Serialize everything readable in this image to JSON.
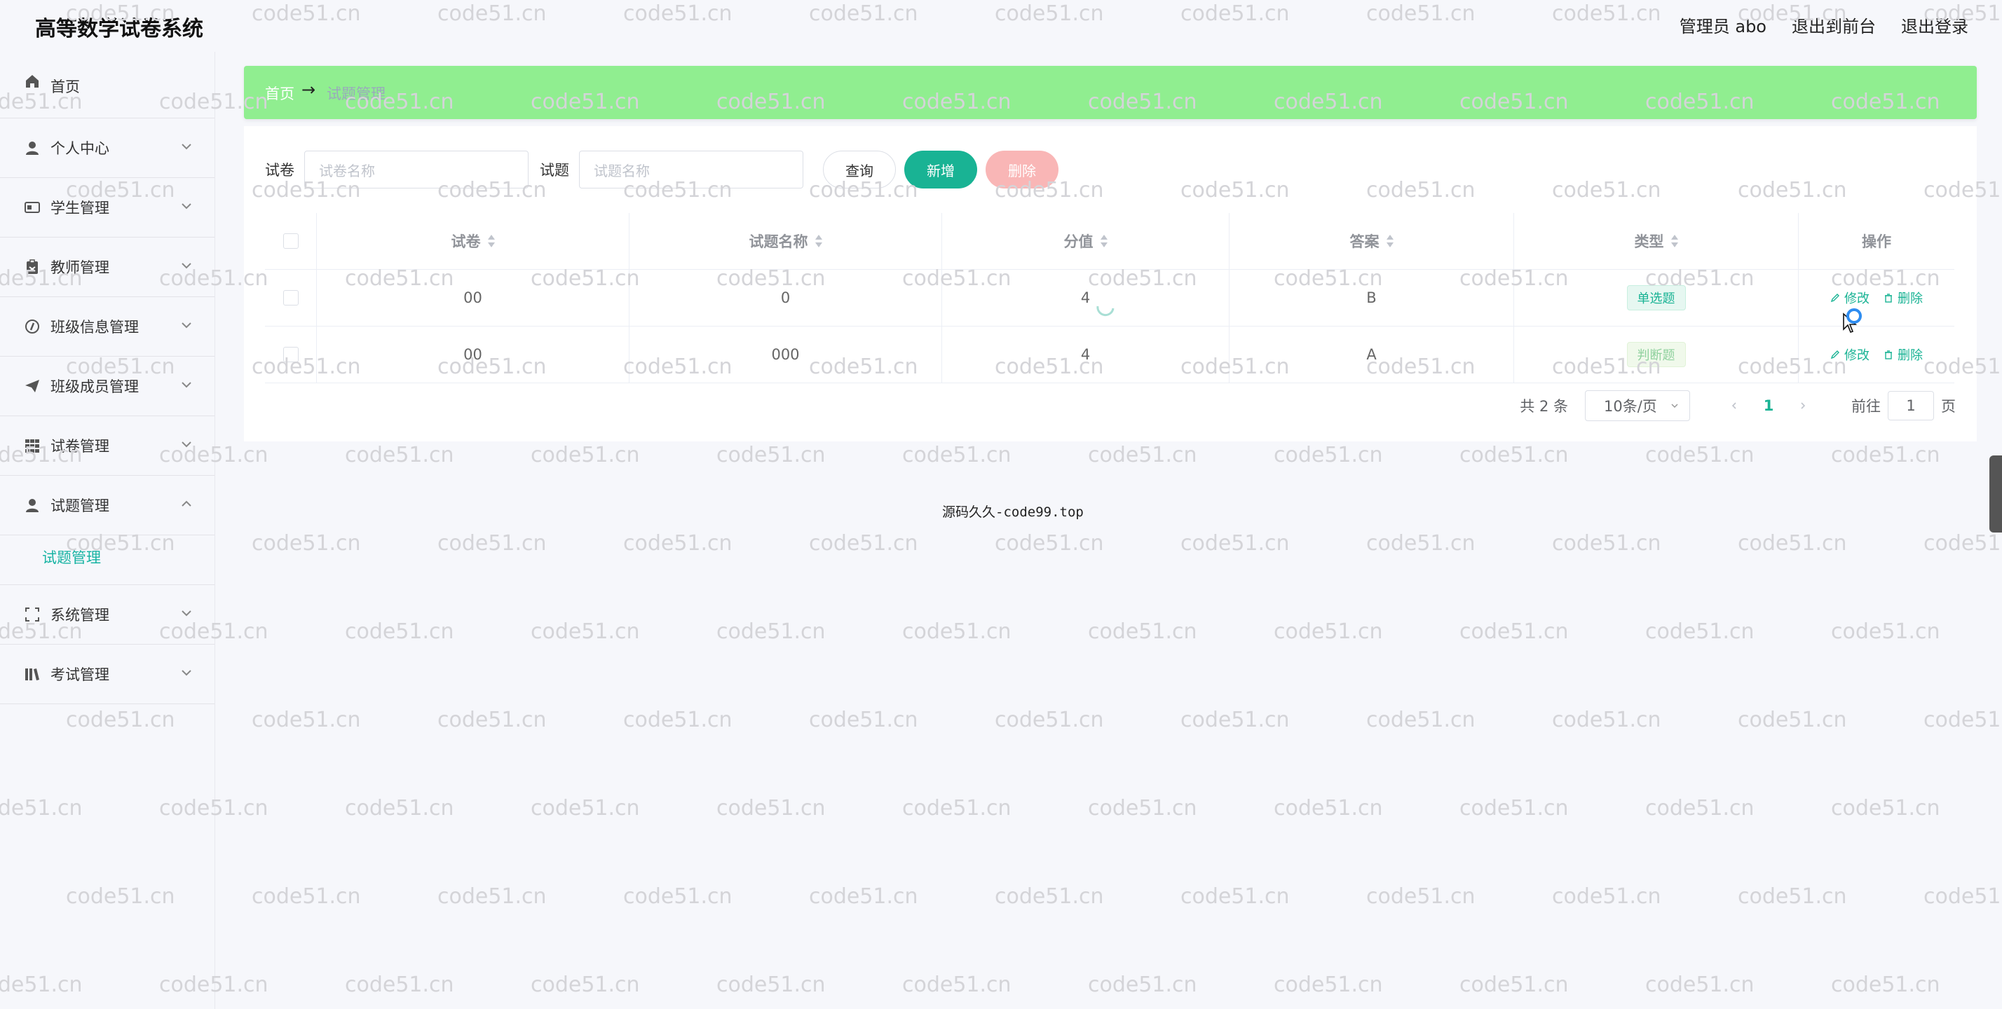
{
  "app": {
    "title": "高等数学试卷系统",
    "top_links": [
      "管理员 abo",
      "退出到前台",
      "退出登录"
    ]
  },
  "sidebar": {
    "items": [
      {
        "label": "首页",
        "icon": "home-icon"
      },
      {
        "label": "个人中心",
        "icon": "user-icon"
      },
      {
        "label": "学生管理",
        "icon": "id-card-icon"
      },
      {
        "label": "教师管理",
        "icon": "clipboard-icon"
      },
      {
        "label": "班级信息管理",
        "icon": "compass-icon"
      },
      {
        "label": "班级成员管理",
        "icon": "send-icon"
      },
      {
        "label": "试卷管理",
        "icon": "grid-icon"
      },
      {
        "label": "试题管理",
        "icon": "user-icon"
      },
      {
        "label": "系统管理",
        "icon": "scan-icon"
      },
      {
        "label": "考试管理",
        "icon": "books-icon"
      }
    ],
    "submenu_label": "试题管理"
  },
  "breadcrumb": {
    "home": "首页",
    "separator": "→",
    "current": "试题管理"
  },
  "search": {
    "paper_label": "试卷",
    "paper_placeholder": "试卷名称",
    "question_label": "试题",
    "question_placeholder": "试题名称",
    "query_btn": "查询",
    "add_btn": "新增",
    "delete_btn": "删除"
  },
  "table": {
    "headers": {
      "paper": "试卷",
      "qname": "试题名称",
      "score": "分值",
      "answer": "答案",
      "type": "类型",
      "ops": "操作"
    },
    "rows": [
      {
        "paper": "00",
        "qname": "0",
        "score": "4",
        "answer": "B",
        "type": "单选题",
        "edit": "修改",
        "delete": "删除"
      },
      {
        "paper": "00",
        "qname": "000",
        "score": "4",
        "answer": "A",
        "type": "判断题",
        "edit": "修改",
        "delete": "删除"
      }
    ]
  },
  "pagination": {
    "total": "共 2 条",
    "page_size": "10条/页",
    "current": "1",
    "goto_label": "前往",
    "goto_value": "1",
    "page_unit": "页"
  },
  "footer": {
    "text": "源码久久-code99.top"
  },
  "watermark": "code51.cn",
  "colors": {
    "accent": "#19b394",
    "breadcrumb_bg": "#90ee90",
    "danger_soft": "#f9b6b6"
  }
}
